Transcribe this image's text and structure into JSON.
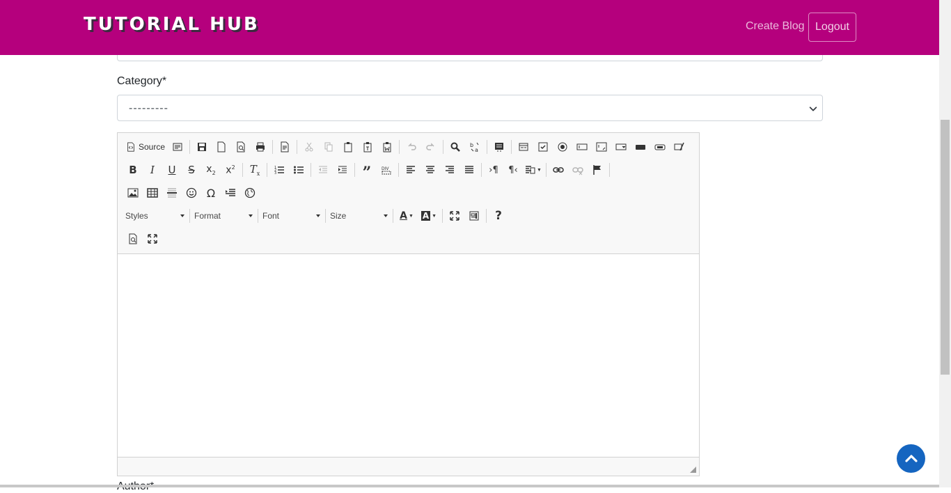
{
  "navbar": {
    "brand": "TUTORIAL HUB",
    "create_blog": "Create Blog",
    "logout": "Logout",
    "bg_color": "#b5007d"
  },
  "form": {
    "category_label": "Category*",
    "category_value": "---------",
    "next_label": "Author*"
  },
  "editor": {
    "source_label": "Source",
    "styles_label": "Styles",
    "format_label": "Format",
    "font_label": "Font",
    "size_label": "Size",
    "help_label": "?"
  }
}
